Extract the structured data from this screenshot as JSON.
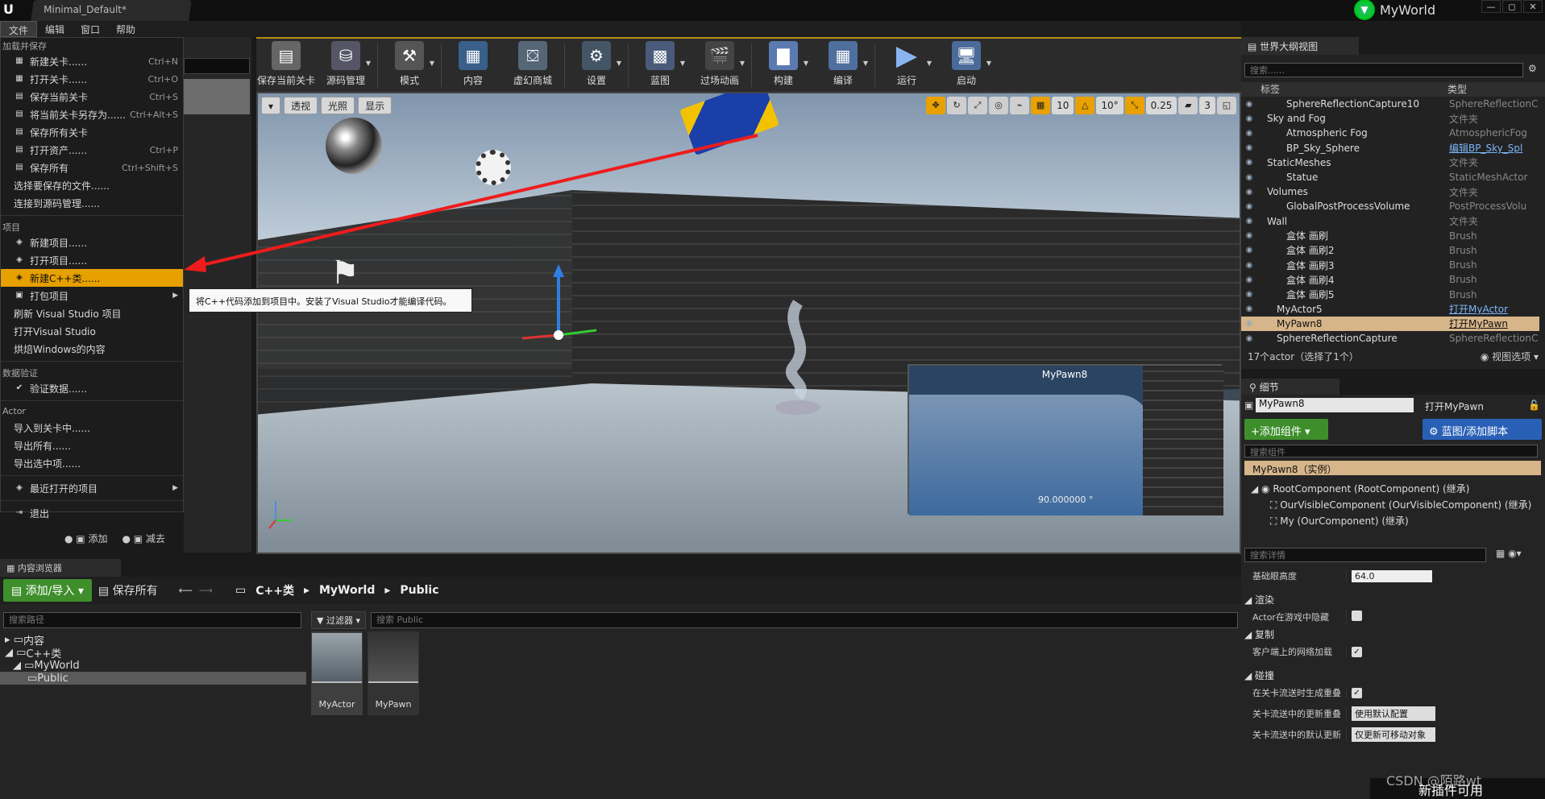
{
  "window": {
    "doc_tab": "Minimal_Default*",
    "world_name": "MyWorld",
    "controls": [
      "—",
      "◻",
      "✕"
    ]
  },
  "menubar": [
    "文件",
    "编辑",
    "窗口",
    "帮助"
  ],
  "file_menu": {
    "section_load_save": "加载并保存",
    "items1": [
      {
        "label": "新建关卡......",
        "shortcut": "Ctrl+N"
      },
      {
        "label": "打开关卡......",
        "shortcut": "Ctrl+O"
      },
      {
        "label": "保存当前关卡",
        "shortcut": "Ctrl+S"
      },
      {
        "label": "将当前关卡另存为......",
        "shortcut": "Ctrl+Alt+S"
      },
      {
        "label": "保存所有关卡",
        "shortcut": ""
      },
      {
        "label": "打开资产......",
        "shortcut": "Ctrl+P"
      },
      {
        "label": "保存所有",
        "shortcut": "Ctrl+Shift+S"
      },
      {
        "label": "选择要保存的文件......",
        "shortcut": ""
      },
      {
        "label": "连接到源码管理......",
        "shortcut": ""
      }
    ],
    "section_project": "项目",
    "items2": [
      {
        "label": "新建项目......"
      },
      {
        "label": "打开项目......"
      },
      {
        "label": "新建C++类......"
      },
      {
        "label": "打包项目"
      },
      {
        "label": "刷新 Visual Studio 项目"
      },
      {
        "label": "打开Visual Studio"
      },
      {
        "label": "烘焙Windows的内容"
      }
    ],
    "section_data": "数据验证",
    "validate": "验证数据......",
    "section_actor": "Actor",
    "items3": [
      {
        "label": "导入到关卡中......"
      },
      {
        "label": "导出所有......"
      },
      {
        "label": "导出选中项......"
      }
    ],
    "recent": "最近打开的项目",
    "exit": "退出"
  },
  "tooltip": "将C++代码添加到项目中。安装了Visual Studio才能编译代码。",
  "toolbar": [
    {
      "label": "保存当前关卡",
      "icon": "save-icon"
    },
    {
      "label": "源码管理",
      "icon": "source-control-icon"
    },
    {
      "label": "模式",
      "icon": "modes-icon"
    },
    {
      "label": "内容",
      "icon": "content-icon"
    },
    {
      "label": "虚幻商城",
      "icon": "marketplace-icon"
    },
    {
      "label": "设置",
      "icon": "settings-icon"
    },
    {
      "label": "蓝图",
      "icon": "blueprint-icon"
    },
    {
      "label": "过场动画",
      "icon": "cinematics-icon"
    },
    {
      "label": "构建",
      "icon": "build-icon"
    },
    {
      "label": "编译",
      "icon": "compile-icon"
    },
    {
      "label": "运行",
      "icon": "play-icon"
    },
    {
      "label": "启动",
      "icon": "launch-icon"
    }
  ],
  "viewport": {
    "perspective": "透视",
    "lighting": "光照",
    "show": "显示",
    "grid_snap": "10",
    "rot_snap": "10°",
    "scale_snap": "0.25",
    "camera_speed": "3",
    "pip_title": "MyPawn8",
    "pip_value": "90.000000 °"
  },
  "left": {
    "add": "添加",
    "subtract": "减去"
  },
  "content_browser": {
    "tab": "内容浏览器",
    "add_import": "添加/导入",
    "save_all": "保存所有",
    "crumbs": [
      "C++类",
      "MyWorld",
      "Public"
    ],
    "path_search": "搜索路径",
    "filter": "过滤器",
    "asset_search": "搜索 Public",
    "tree": [
      {
        "label": "内容",
        "depth": 0
      },
      {
        "label": "C++类",
        "depth": 0
      },
      {
        "label": "MyWorld",
        "depth": 1
      },
      {
        "label": "Public",
        "depth": 2
      }
    ],
    "assets": [
      "MyActor",
      "MyPawn"
    ]
  },
  "outliner": {
    "tab": "世界大纲视图",
    "search": "搜索......",
    "col_label": "标签",
    "col_type": "类型",
    "rows": [
      {
        "name": "SphereReflectionCapture10",
        "type": "SphereReflectionC",
        "indent": 3
      },
      {
        "name": "Sky and Fog",
        "type": "文件夹",
        "indent": 1
      },
      {
        "name": "Atmospheric Fog",
        "type": "AtmosphericFog",
        "indent": 3
      },
      {
        "name": "BP_Sky_Sphere",
        "type": "编辑BP_Sky_Spl",
        "indent": 3,
        "link": true
      },
      {
        "name": "StaticMeshes",
        "type": "文件夹",
        "indent": 1
      },
      {
        "name": "Statue",
        "type": "StaticMeshActor",
        "indent": 3
      },
      {
        "name": "Volumes",
        "type": "文件夹",
        "indent": 1
      },
      {
        "name": "GlobalPostProcessVolume",
        "type": "PostProcessVolu",
        "indent": 3
      },
      {
        "name": "Wall",
        "type": "文件夹",
        "indent": 1
      },
      {
        "name": "盒体 画刷",
        "type": "Brush",
        "indent": 3
      },
      {
        "name": "盒体 画刷2",
        "type": "Brush",
        "indent": 3
      },
      {
        "name": "盒体 画刷3",
        "type": "Brush",
        "indent": 3
      },
      {
        "name": "盒体 画刷4",
        "type": "Brush",
        "indent": 3
      },
      {
        "name": "盒体 画刷5",
        "type": "Brush",
        "indent": 3
      },
      {
        "name": "MyActor5",
        "type": "打开MyActor",
        "indent": 2,
        "link": true
      },
      {
        "name": "MyPawn8",
        "type": "打开MyPawn",
        "indent": 2,
        "link": true,
        "selected": true
      },
      {
        "name": "SphereReflectionCapture",
        "type": "SphereReflectionC",
        "indent": 2
      }
    ],
    "footer": "17个actor（选择了1个）",
    "view_options": "视图选项"
  },
  "details": {
    "tab": "细节",
    "name": "MyPawn8",
    "open_pawn": "打开MyPawn",
    "add_component": "+添加组件",
    "blueprint_btn": "蓝图/添加脚本",
    "comp_search": "搜索组件",
    "root": "MyPawn8（实例）",
    "components": [
      "RootComponent (RootComponent) (继承)",
      "OurVisibleComponent (OurVisibleComponent) (继承)",
      "My (OurComponent) (继承)"
    ],
    "detail_search": "搜索详情",
    "base_eye": "基础眼高度",
    "base_eye_val": "64.0",
    "sec_render": "渲染",
    "hidden_in_game": "Actor在游戏中隐藏",
    "sec_replication": "复制",
    "net_load_client": "客户端上的网络加载",
    "sec_collision": "碰撞",
    "gen_overlap": "在关卡流送时生成重叠",
    "update_overlap": "关卡流送中的更新重叠",
    "update_overlap_val": "使用默认配置",
    "default_update": "关卡流送中的默认更新",
    "default_update_val": "仅更新可移动对象"
  },
  "toast": "新插件可用",
  "watermark": "CSDN @陌路wt"
}
